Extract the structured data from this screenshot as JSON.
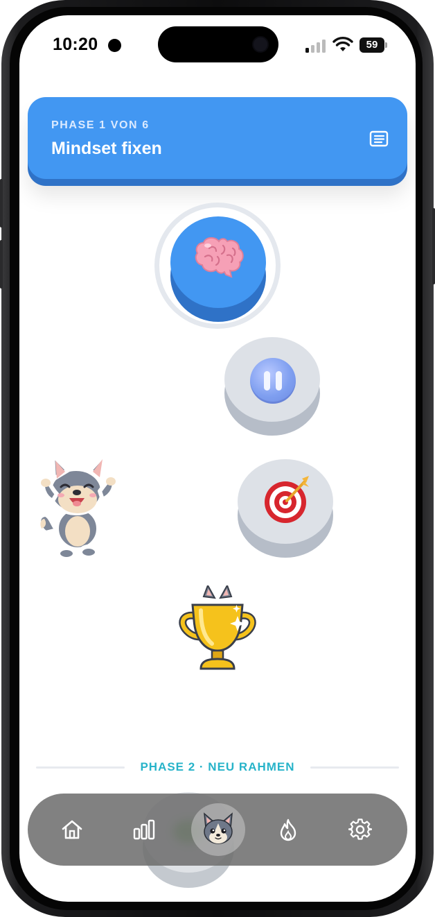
{
  "status_bar": {
    "time": "10:20",
    "battery": "59"
  },
  "phase_banner": {
    "kicker": "PHASE 1 VON 6",
    "title": "Mindset fixen",
    "color": "#4297f2",
    "shadow_color": "#2f72c7",
    "guide_icon": "guidebook-icon"
  },
  "path": {
    "nodes": [
      {
        "state": "current",
        "icon": "brain-icon"
      },
      {
        "state": "locked",
        "icon": "pause-icon"
      },
      {
        "state": "locked",
        "icon": "target-icon"
      },
      {
        "state": "locked",
        "icon": "trophy-icon"
      }
    ],
    "mascot": "wolf-mascot"
  },
  "next_phase_divider": {
    "label": "PHASE 2 · NEU RAHMEN",
    "color": "#27b3c9"
  },
  "tab_bar": {
    "items": [
      {
        "id": "home",
        "icon": "home-icon",
        "active": false
      },
      {
        "id": "stats",
        "icon": "bar-chart-icon",
        "active": false
      },
      {
        "id": "learn",
        "icon": "wolf-avatar-icon",
        "active": true
      },
      {
        "id": "streak",
        "icon": "flame-icon",
        "active": false
      },
      {
        "id": "settings",
        "icon": "gear-icon",
        "active": false
      }
    ]
  }
}
